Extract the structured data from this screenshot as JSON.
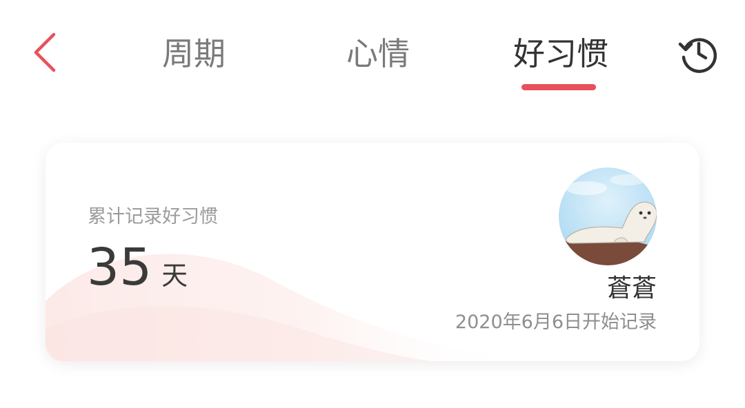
{
  "header": {
    "back_icon": "chevron-left-icon",
    "tabs": [
      {
        "label": "周期",
        "active": false
      },
      {
        "label": "心情",
        "active": false
      },
      {
        "label": "好习惯",
        "active": true
      }
    ],
    "history_icon": "history-clock-icon",
    "accent_color": "#e8505b"
  },
  "card": {
    "label": "累计记录好习惯",
    "count": "35",
    "unit": "天",
    "avatar_icon": "seal-avatar",
    "username": "蒼蒼",
    "start_text": "2020年6月6日开始记录"
  }
}
